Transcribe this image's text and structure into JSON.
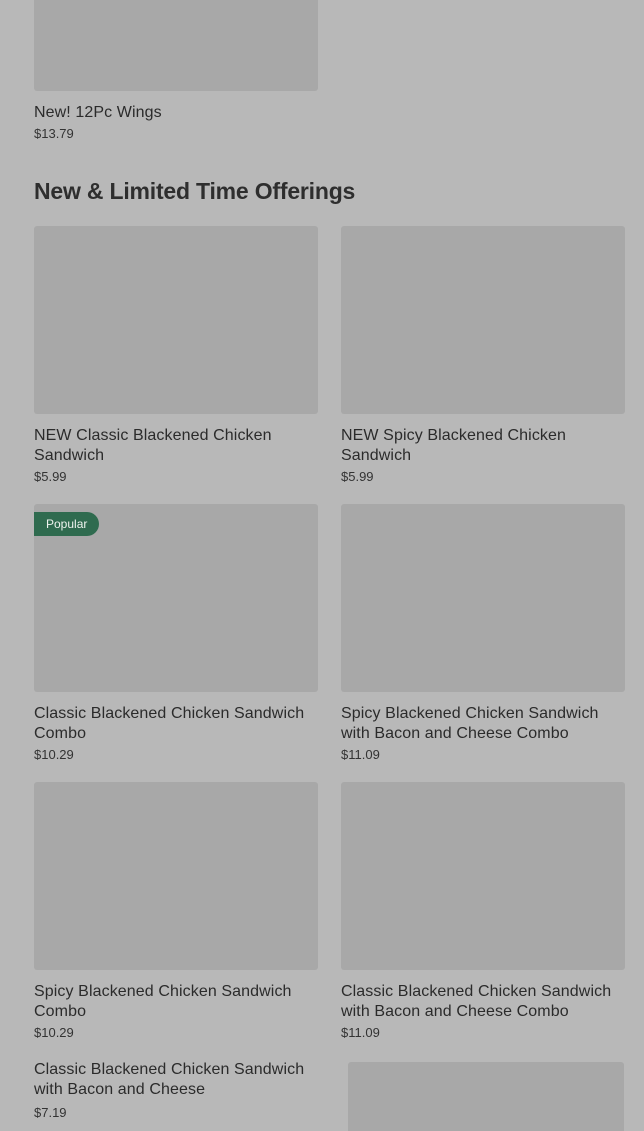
{
  "top_item": {
    "name": "New! 12Pc Wings",
    "price": "$13.79"
  },
  "section": {
    "title": "New & Limited Time Offerings",
    "items": [
      {
        "name": "NEW Classic Blackened Chicken Sandwich",
        "price": "$5.99",
        "badge": ""
      },
      {
        "name": "NEW Spicy Blackened Chicken Sandwich",
        "price": "$5.99",
        "badge": ""
      },
      {
        "name": "Classic Blackened Chicken Sandwich Combo",
        "price": "$10.29",
        "badge": "Popular"
      },
      {
        "name": "Spicy Blackened Chicken Sandwich with Bacon and Cheese Combo",
        "price": "$11.09",
        "badge": ""
      },
      {
        "name": "Spicy Blackened Chicken Sandwich Combo",
        "price": "$10.29",
        "badge": ""
      },
      {
        "name": "Classic Blackened Chicken Sandwich with Bacon and Cheese Combo",
        "price": "$11.09",
        "badge": ""
      },
      {
        "name": "Classic Blackened Chicken Sandwich with Bacon and Cheese",
        "price": "$7.19",
        "badge": ""
      }
    ]
  },
  "colors": {
    "background": "#b8b8b8",
    "image_placeholder": "#a8a8a8",
    "badge": "#2f6b4f"
  }
}
